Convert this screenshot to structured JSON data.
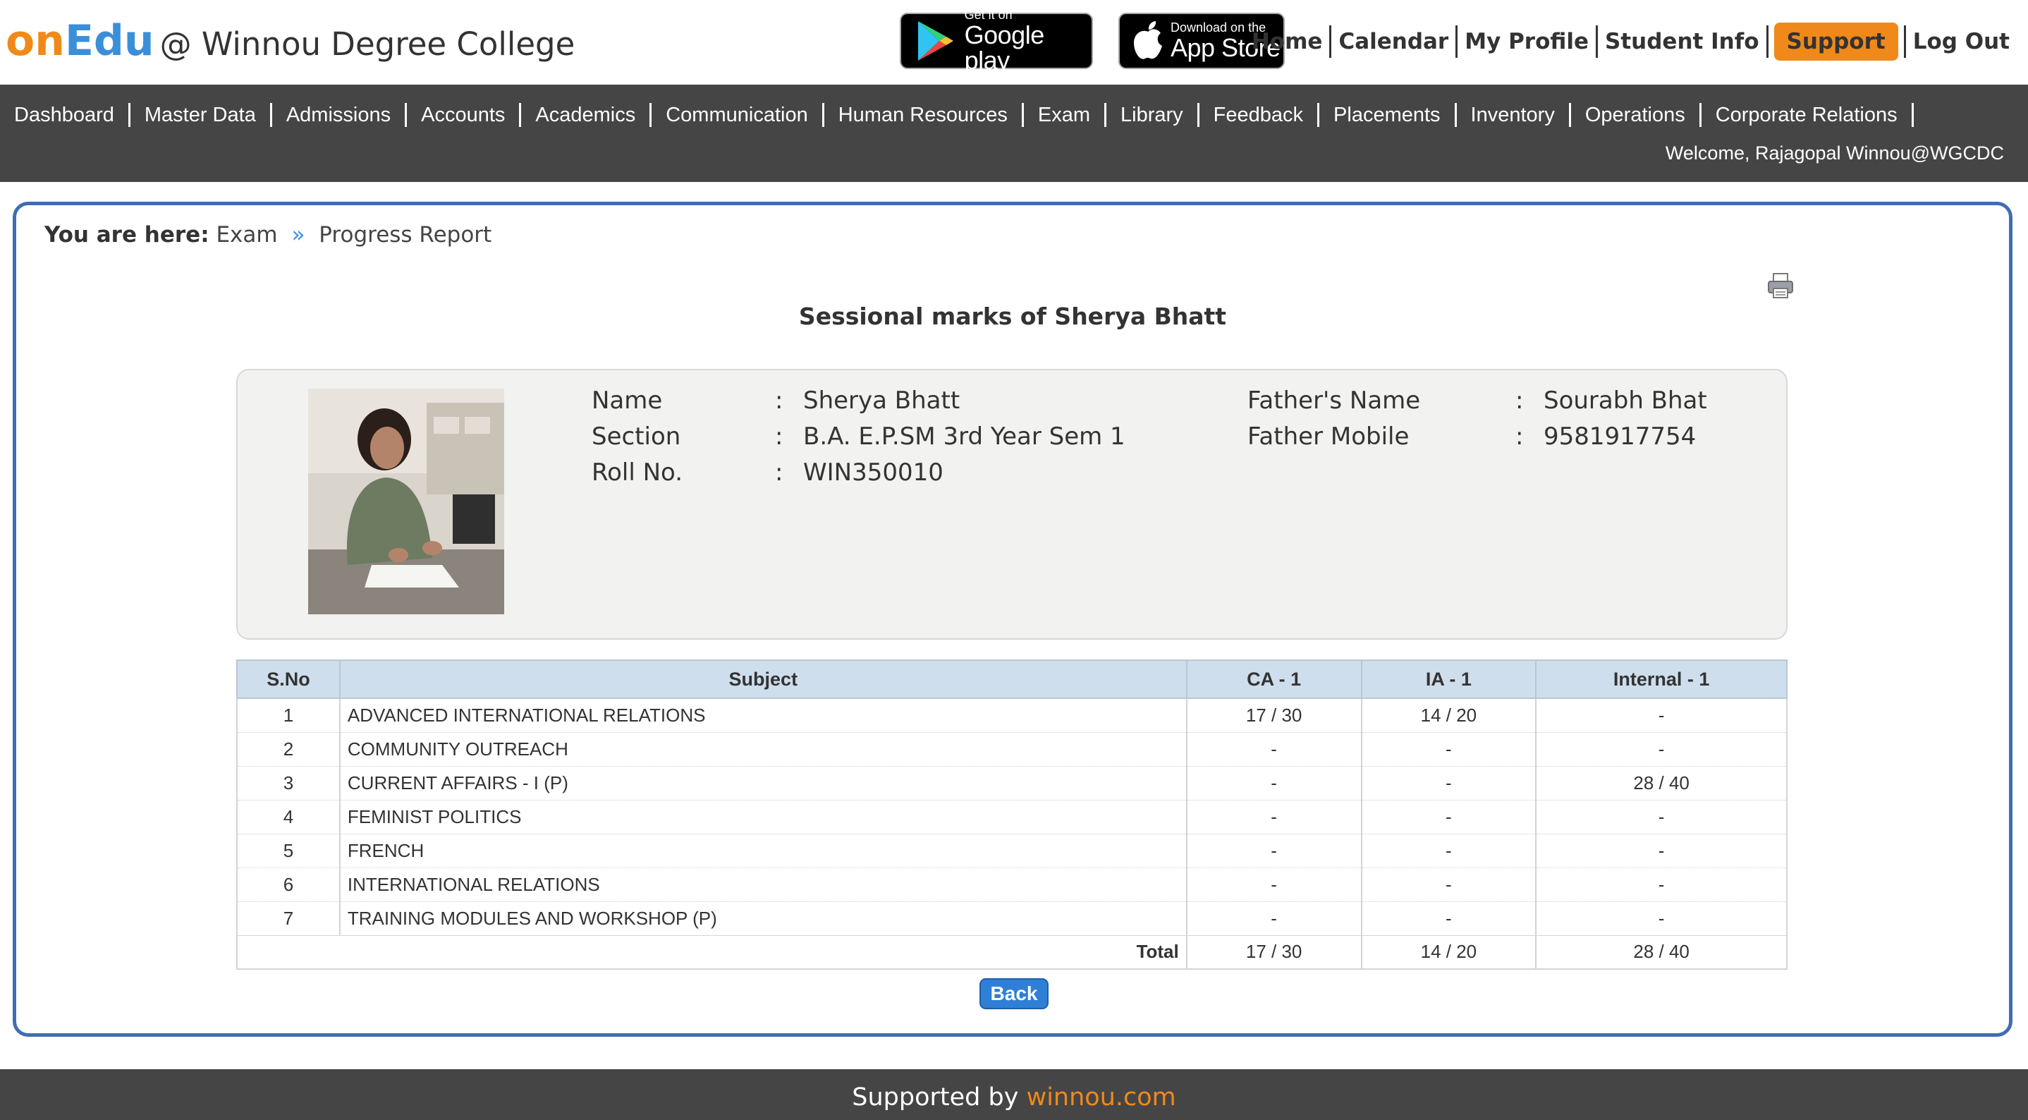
{
  "brand": {
    "on": "on",
    "edu": "Edu",
    "college": "@ Winnou Degree College",
    "accent_orange": "#f0891a",
    "accent_blue": "#3b8fd8"
  },
  "badges": {
    "google_play": {
      "small": "Get it on",
      "big": "Google play"
    },
    "app_store": {
      "small": "Download on the",
      "big": "App Store"
    }
  },
  "top_nav": {
    "home": "Home",
    "calendar": "Calendar",
    "my_profile": "My Profile",
    "student_info": "Student Info",
    "support": "Support",
    "log_out": "Log Out"
  },
  "main_menu": [
    "Dashboard",
    "Master Data",
    "Admissions",
    "Accounts",
    "Academics",
    "Communication",
    "Human Resources",
    "Exam",
    "Library",
    "Feedback",
    "Placements",
    "Inventory",
    "Operations",
    "Corporate Relations"
  ],
  "welcome": "Welcome, Rajagopal Winnou@WGCDC",
  "breadcrumb": {
    "label": "You are here:",
    "items": [
      "Exam",
      "Progress Report"
    ],
    "separator": "»"
  },
  "report_title": "Sessional marks of Sherya Bhatt",
  "student": {
    "left": [
      {
        "key": "Name",
        "value": "Sherya Bhatt"
      },
      {
        "key": "Section",
        "value": "B.A. E.P.SM 3rd Year Sem 1"
      },
      {
        "key": "Roll No.",
        "value": "WIN350010"
      }
    ],
    "right": [
      {
        "key": "Father's Name",
        "value": "Sourabh Bhat"
      },
      {
        "key": "Father Mobile",
        "value": "9581917754"
      }
    ],
    "colon": ":"
  },
  "marks_table": {
    "headers": [
      "S.No",
      "Subject",
      "CA - 1",
      "IA - 1",
      "Internal - 1"
    ],
    "rows": [
      [
        "1",
        "ADVANCED INTERNATIONAL RELATIONS",
        "17 / 30",
        "14 / 20",
        "-"
      ],
      [
        "2",
        "COMMUNITY OUTREACH",
        "-",
        "-",
        "-"
      ],
      [
        "3",
        "CURRENT AFFAIRS - I (P)",
        "-",
        "-",
        "28 / 40"
      ],
      [
        "4",
        "FEMINIST POLITICS",
        "-",
        "-",
        "-"
      ],
      [
        "5",
        "FRENCH",
        "-",
        "-",
        "-"
      ],
      [
        "6",
        "INTERNATIONAL RELATIONS",
        "-",
        "-",
        "-"
      ],
      [
        "7",
        "TRAINING MODULES AND WORKSHOP (P)",
        "-",
        "-",
        "-"
      ]
    ],
    "total": {
      "label": "Total",
      "values": [
        "17 / 30",
        "14 / 20",
        "28 / 40"
      ]
    }
  },
  "back_label": "Back",
  "footer": {
    "text": "Supported by",
    "site": "winnou.com"
  }
}
